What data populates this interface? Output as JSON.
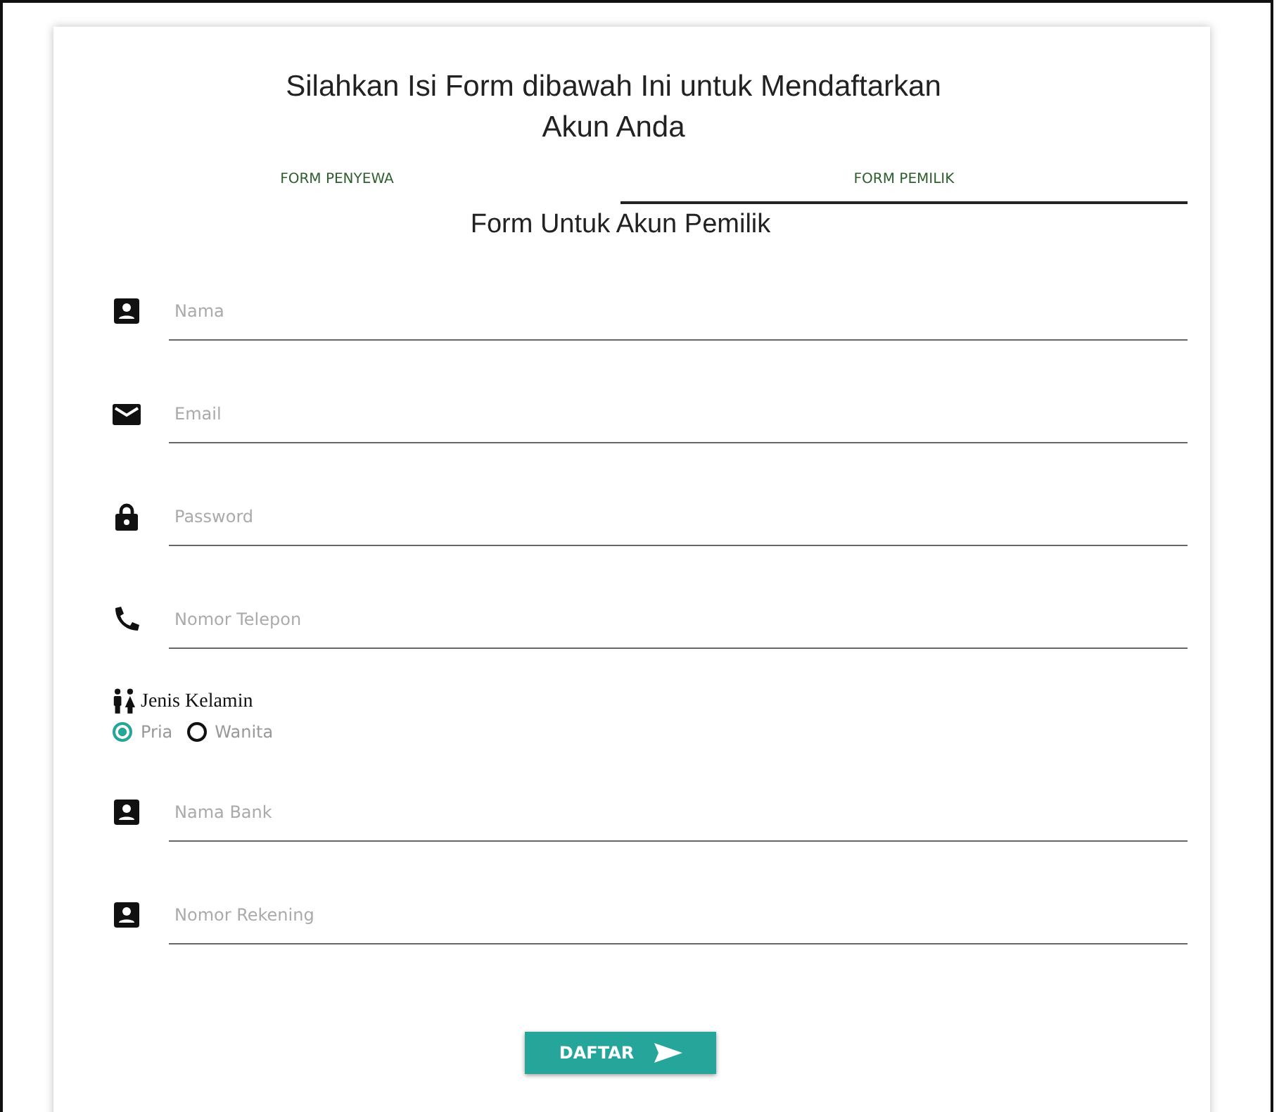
{
  "title": "Silahkan Isi Form dibawah Ini untuk Mendaftarkan Akun Anda",
  "tabs": [
    {
      "label": "FORM PENYEWA",
      "selected": false
    },
    {
      "label": "FORM PEMILIK",
      "selected": true
    }
  ],
  "form_title": "Form Untuk Akun Pemilik",
  "fields_top": [
    {
      "kind": "text",
      "placeholder": "Nama"
    },
    {
      "kind": "email",
      "placeholder": "Email"
    },
    {
      "kind": "password",
      "placeholder": "Password"
    },
    {
      "kind": "tel",
      "placeholder": "Nomor Telepon"
    }
  ],
  "gender": {
    "label": "Jenis Kelamin",
    "options": [
      {
        "label": "Pria",
        "selected": true
      },
      {
        "label": "Wanita",
        "selected": false
      }
    ]
  },
  "fields_bottom": [
    {
      "kind": "text",
      "placeholder": "Nama Bank"
    },
    {
      "kind": "text",
      "placeholder": "Nomor Rekening"
    }
  ],
  "submit": "DAFTAR"
}
